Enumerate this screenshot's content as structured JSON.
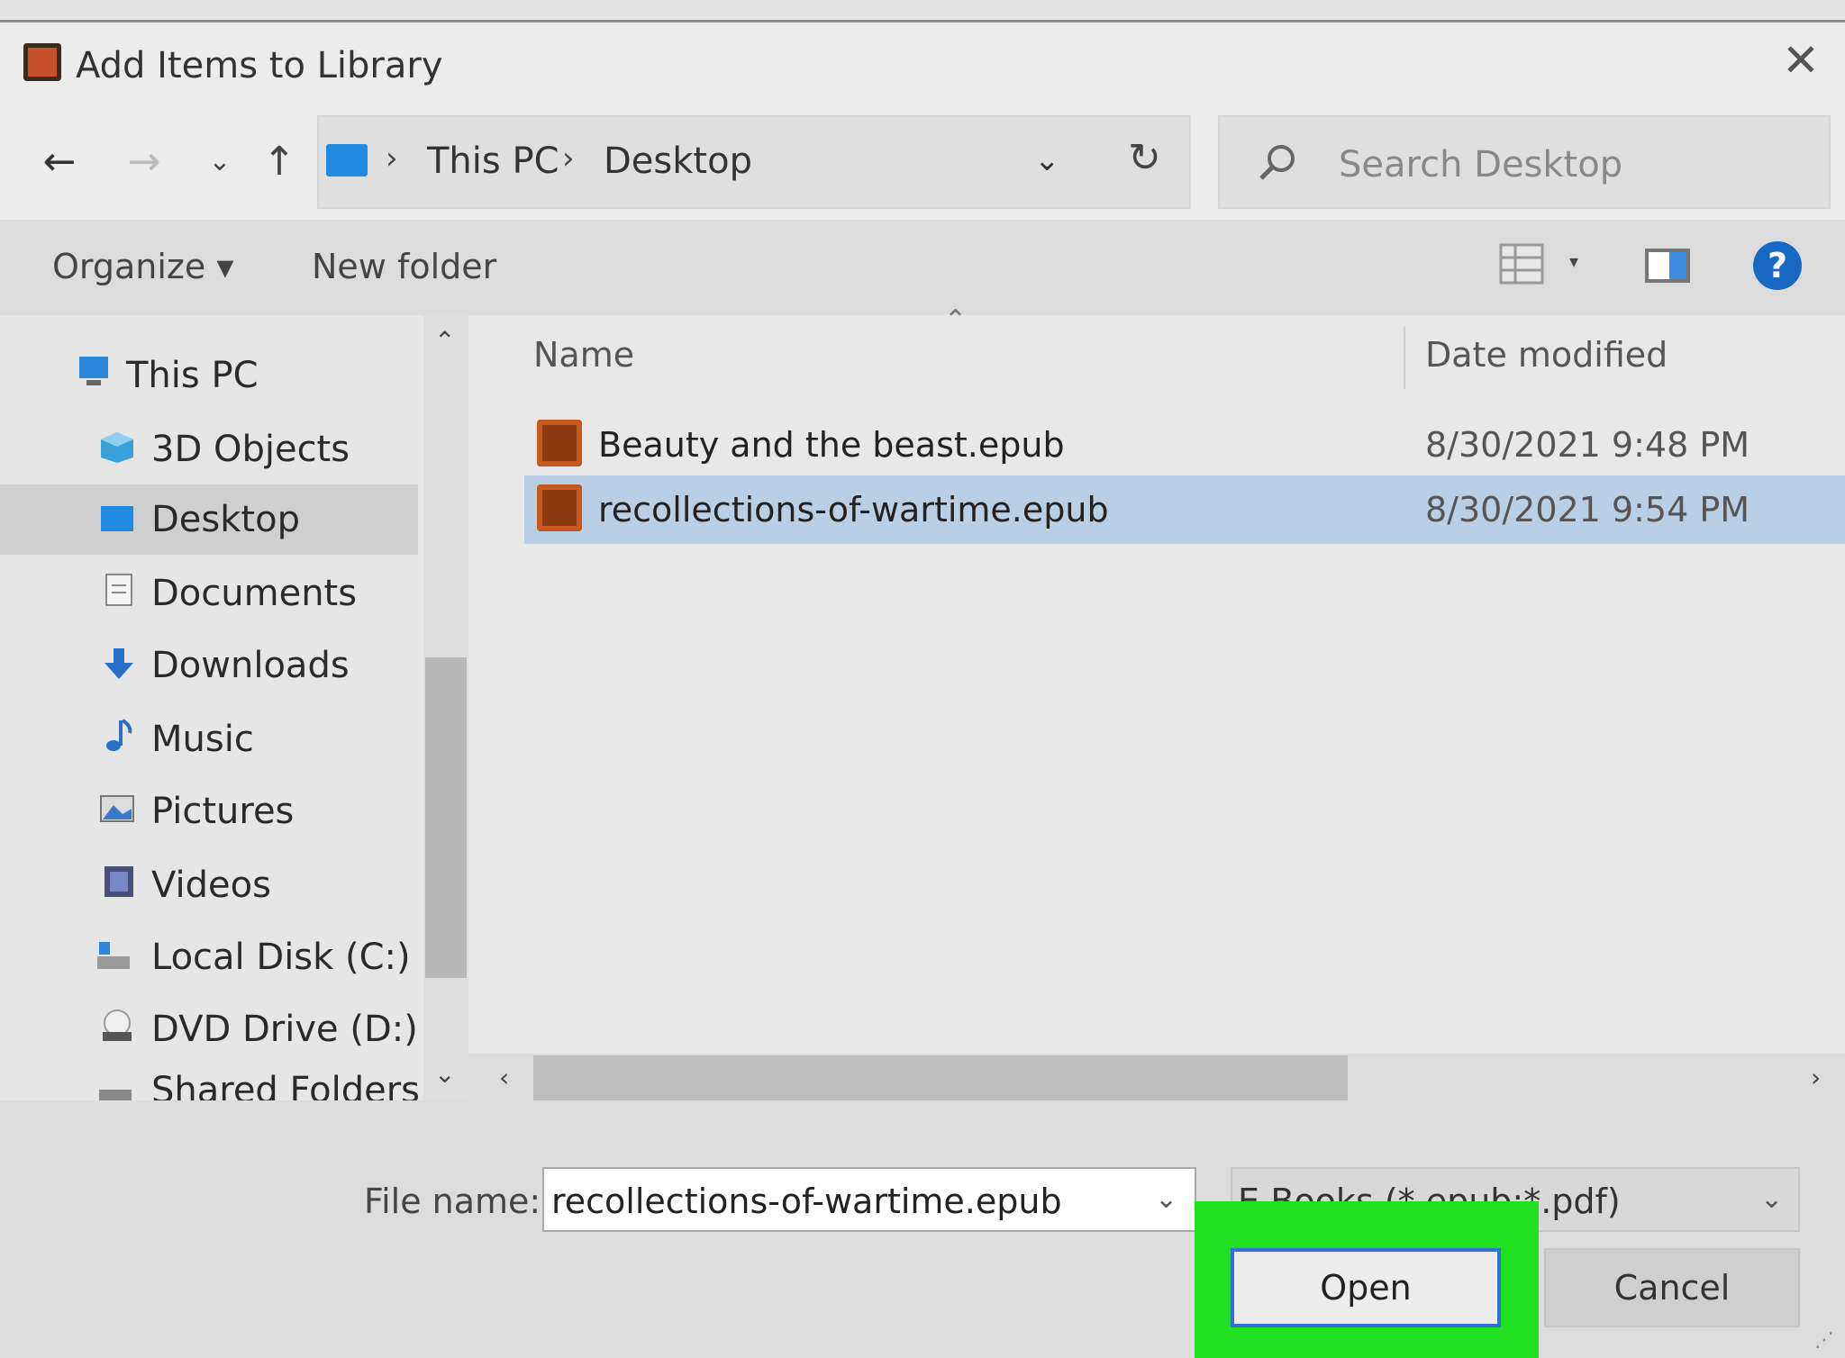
{
  "dialog": {
    "title": "Add Items to Library",
    "close_glyph": "✕"
  },
  "address_bar": {
    "back_glyph": "←",
    "forward_glyph": "→",
    "recent_glyph": "⌄",
    "up_glyph": "↑",
    "crumbs": [
      "This PC",
      "Desktop"
    ],
    "separator": "›",
    "dropdown_glyph": "⌄",
    "refresh_glyph": "↻"
  },
  "search": {
    "placeholder": "Search Desktop"
  },
  "toolbar": {
    "organize_label": "Organize ▾",
    "new_folder_label": "New folder",
    "view_dropdown_glyph": "▾",
    "help_glyph": "?"
  },
  "nav_pane": {
    "items": [
      {
        "label": "This PC",
        "icon": "computer-icon"
      },
      {
        "label": "3D Objects",
        "icon": "cube-icon"
      },
      {
        "label": "Desktop",
        "icon": "desktop-icon",
        "selected": true
      },
      {
        "label": "Documents",
        "icon": "document-icon"
      },
      {
        "label": "Downloads",
        "icon": "download-arrow-icon"
      },
      {
        "label": "Music",
        "icon": "music-note-icon"
      },
      {
        "label": "Pictures",
        "icon": "picture-icon"
      },
      {
        "label": "Videos",
        "icon": "film-icon"
      },
      {
        "label": "Local Disk (C:)",
        "icon": "hard-drive-icon"
      },
      {
        "label": "DVD Drive (D:) M",
        "icon": "dvd-drive-icon"
      },
      {
        "label": "Shared Folders (\\",
        "icon": "network-folder-icon"
      }
    ],
    "scroll_up_glyph": "⌃",
    "scroll_down_glyph": "⌄"
  },
  "file_list": {
    "sort_glyph": "⌃",
    "columns": [
      "Name",
      "Date modified"
    ],
    "rows": [
      {
        "name": "Beauty and the beast.epub",
        "date": "8/30/2021 9:48 PM",
        "selected": false
      },
      {
        "name": "recollections-of-wartime.epub",
        "date": "8/30/2021 9:54 PM",
        "selected": true
      }
    ],
    "scroll_left_glyph": "‹",
    "scroll_right_glyph": "›"
  },
  "footer": {
    "file_name_label": "File name:",
    "file_name_value": "recollections-of-wartime.epub",
    "file_name_dd_glyph": "⌄",
    "file_type_value": "E-Books (*.epub;*.pdf)",
    "file_type_dd_glyph": "⌄",
    "open_label": "Open",
    "cancel_label": "Cancel",
    "grip_glyph": "⋰"
  },
  "colors": {
    "selection": "#b8cfe6",
    "highlight": "#21e021",
    "help": "#1767c4",
    "folder_blue": "#1f8ae0"
  }
}
